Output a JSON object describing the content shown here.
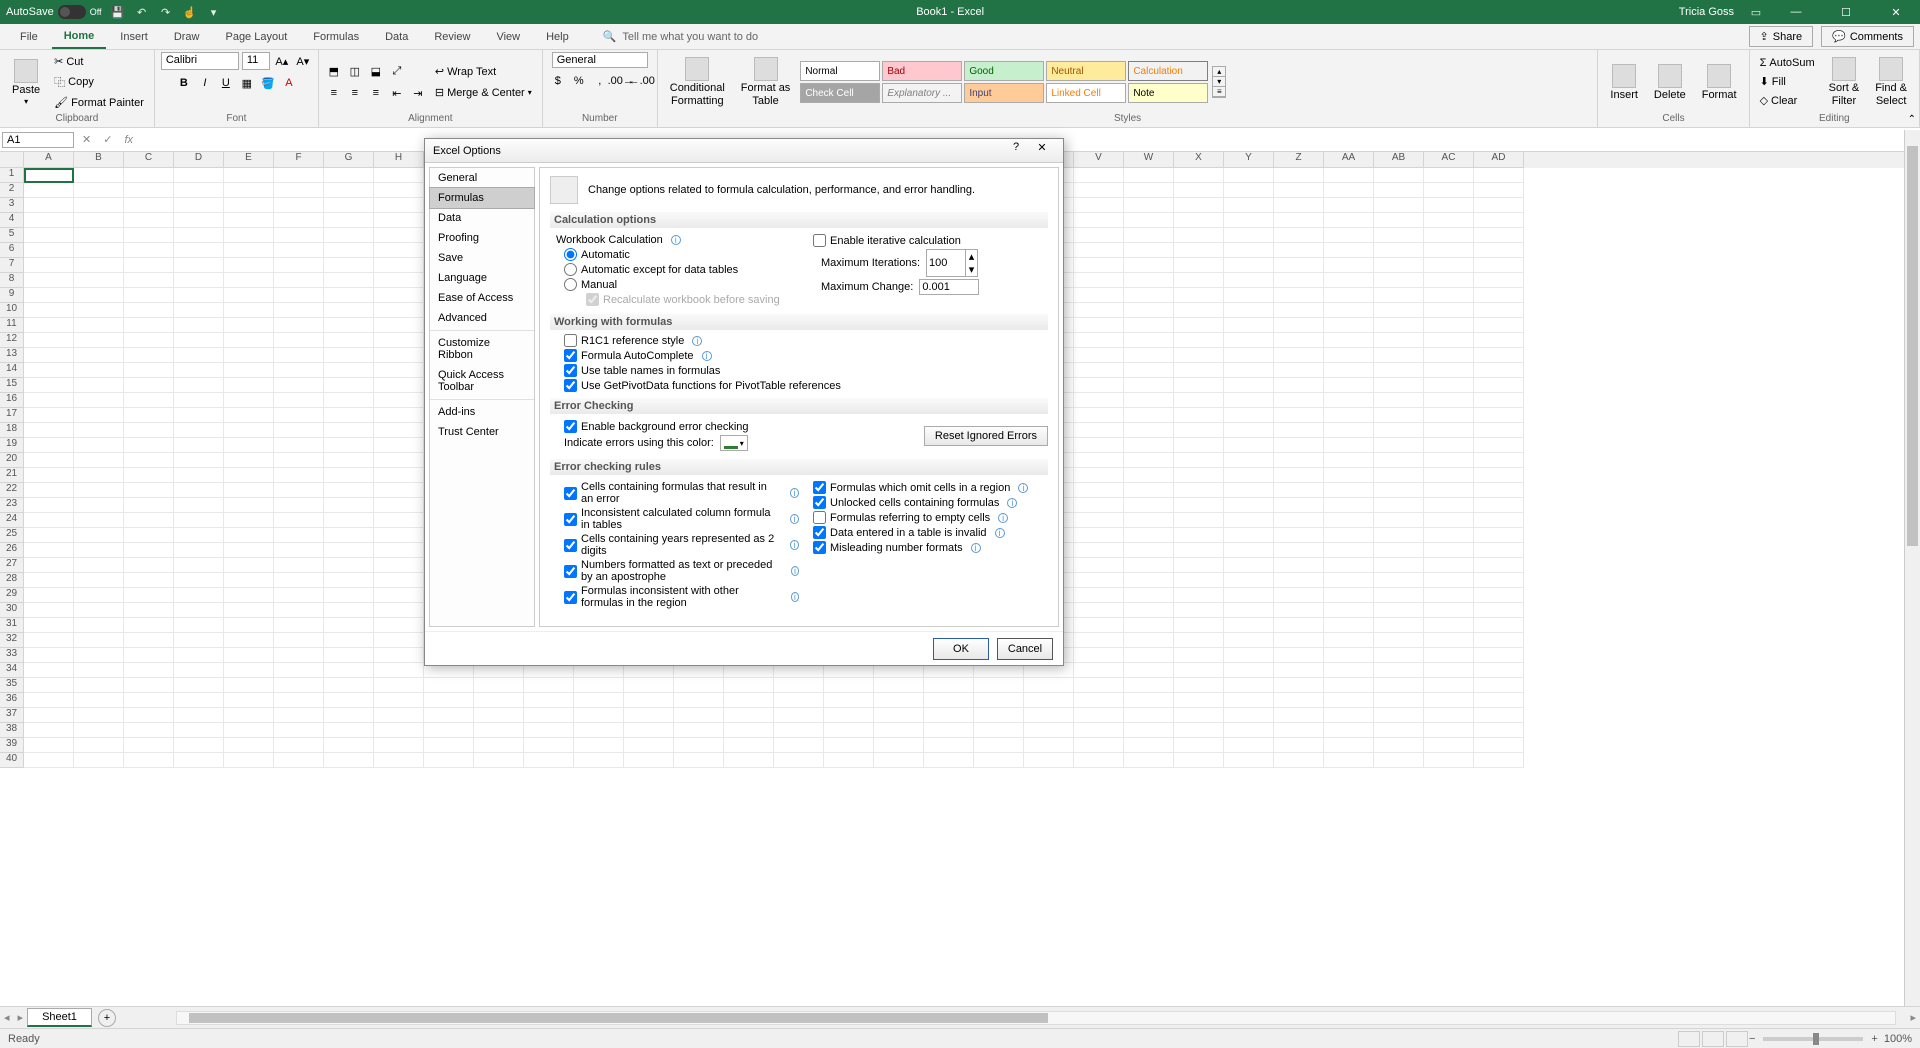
{
  "titlebar": {
    "autosave_label": "AutoSave",
    "autosave_state": "Off",
    "doc": "Book1  -  Excel",
    "user": "Tricia Goss"
  },
  "tabs": {
    "file": "File",
    "home": "Home",
    "insert": "Insert",
    "draw": "Draw",
    "page_layout": "Page Layout",
    "formulas": "Formulas",
    "data": "Data",
    "review": "Review",
    "view": "View",
    "help": "Help",
    "tellme": "Tell me what you want to do",
    "share": "Share",
    "comments": "Comments"
  },
  "clip": {
    "cut": "Cut",
    "copy": "Copy",
    "fp": "Format Painter",
    "label": "Clipboard",
    "paste": "Paste"
  },
  "font": {
    "family": "Calibri",
    "size": "11",
    "label": "Font"
  },
  "align": {
    "wrap": "Wrap Text",
    "merge": "Merge & Center",
    "label": "Alignment"
  },
  "number": {
    "fmt": "General",
    "label": "Number"
  },
  "styles": {
    "cf": "Conditional",
    "cf2": "Formatting",
    "ft": "Format as",
    "ft2": "Table",
    "label": "Styles",
    "normal": "Normal",
    "bad": "Bad",
    "good": "Good",
    "neutral": "Neutral",
    "calc": "Calculation",
    "check": "Check Cell",
    "explan": "Explanatory ...",
    "input": "Input",
    "linked": "Linked Cell",
    "note": "Note"
  },
  "cells": {
    "insert": "Insert",
    "delete": "Delete",
    "format": "Format",
    "label": "Cells"
  },
  "editing": {
    "autosum": "AutoSum",
    "fill": "Fill",
    "clear": "Clear",
    "sort": "Sort &",
    "sort2": "Filter",
    "find": "Find &",
    "find2": "Select",
    "label": "Editing"
  },
  "namebox": "A1",
  "sheet_tab": "Sheet1",
  "cols": [
    "A",
    "B",
    "C",
    "D",
    "E",
    "F",
    "G",
    "H",
    "V",
    "W",
    "X",
    "Y",
    "Z",
    "AA",
    "AB",
    "AC"
  ],
  "status": {
    "ready": "Ready",
    "zoom": "100%"
  },
  "dialog": {
    "title": "Excel Options",
    "nav": [
      "General",
      "Formulas",
      "Data",
      "Proofing",
      "Save",
      "Language",
      "Ease of Access",
      "Advanced",
      "Customize Ribbon",
      "Quick Access Toolbar",
      "Add-ins",
      "Trust Center"
    ],
    "desc": "Change options related to formula calculation, performance, and error handling.",
    "s1": "Calculation options",
    "wc": "Workbook Calculation",
    "auto": "Automatic",
    "autodata": "Automatic except for data tables",
    "manual": "Manual",
    "recalc": "Recalculate workbook before saving",
    "iter": "Enable iterative calculation",
    "maxit": "Maximum Iterations:",
    "maxit_v": "100",
    "maxch": "Maximum Change:",
    "maxch_v": "0.001",
    "s2": "Working with formulas",
    "r1c1": "R1C1 reference style",
    "autocomp": "Formula AutoComplete",
    "tblnames": "Use table names in formulas",
    "gpd": "Use GetPivotData functions for PivotTable references",
    "s3": "Error Checking",
    "bgchk": "Enable background error checking",
    "indcolor": "Indicate errors using this color:",
    "reset": "Reset Ignored Errors",
    "s4": "Error checking rules",
    "r_err": "Cells containing formulas that result in an error",
    "r_incon": "Inconsistent calculated column formula in tables",
    "r_year": "Cells containing years represented as 2 digits",
    "r_numtxt": "Numbers formatted as text or preceded by an apostrophe",
    "r_region": "Formulas inconsistent with other formulas in the region",
    "r_omit": "Formulas which omit cells in a region",
    "r_unlock": "Unlocked cells containing formulas",
    "r_empty": "Formulas referring to empty cells",
    "r_table": "Data entered in a table is invalid",
    "r_misnum": "Misleading number formats",
    "ok": "OK",
    "cancel": "Cancel"
  }
}
